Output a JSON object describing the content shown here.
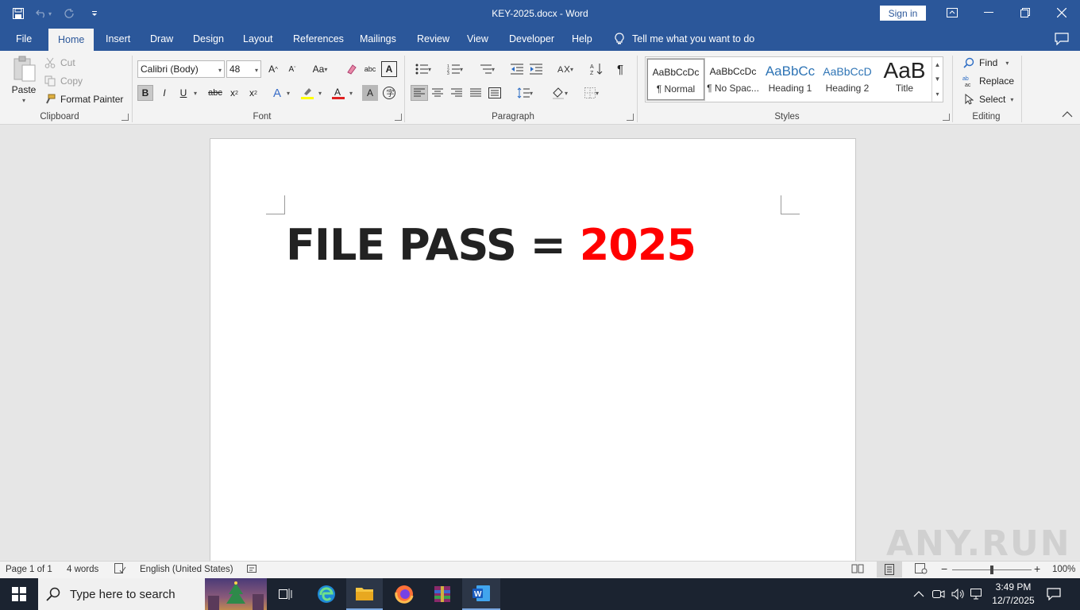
{
  "window": {
    "title": "KEY-2025.docx  -  Word",
    "signin_label": "Sign in"
  },
  "tabs": [
    {
      "label": "File"
    },
    {
      "label": "Home"
    },
    {
      "label": "Insert"
    },
    {
      "label": "Draw"
    },
    {
      "label": "Design"
    },
    {
      "label": "Layout"
    },
    {
      "label": "References"
    },
    {
      "label": "Mailings"
    },
    {
      "label": "Review"
    },
    {
      "label": "View"
    },
    {
      "label": "Developer"
    },
    {
      "label": "Help"
    }
  ],
  "tell_me": "Tell me what you want to do",
  "ribbon": {
    "clipboard": {
      "label": "Clipboard",
      "paste": "Paste",
      "cut": "Cut",
      "copy": "Copy",
      "format_painter": "Format Painter"
    },
    "font": {
      "label": "Font",
      "font_name": "Calibri (Body)",
      "font_size": "48"
    },
    "paragraph": {
      "label": "Paragraph"
    },
    "styles": {
      "label": "Styles",
      "items": [
        {
          "preview": "AaBbCcDc",
          "name": "¶ Normal"
        },
        {
          "preview": "AaBbCcDc",
          "name": "¶ No Spac..."
        },
        {
          "preview": "AaBbCc",
          "name": "Heading 1"
        },
        {
          "preview": "AaBbCcD",
          "name": "Heading 2"
        },
        {
          "preview": "AaB",
          "name": "Title"
        }
      ]
    },
    "editing": {
      "label": "Editing",
      "find": "Find",
      "replace": "Replace",
      "select": "Select"
    }
  },
  "document": {
    "text_black": "FILE PASS = ",
    "text_red": "2025",
    "red_color": "#ff0000"
  },
  "statusbar": {
    "page": "Page 1 of 1",
    "words": "4 words",
    "language": "English (United States)",
    "zoom": "100%"
  },
  "taskbar": {
    "search_placeholder": "Type here to search",
    "time": "3:49 PM",
    "date": "12/7/2025"
  },
  "watermark": "ANY.RUN",
  "colors": {
    "word_blue": "#2b579a",
    "ribbon_bg": "#f3f3f3",
    "taskbar_bg": "#1b2330"
  }
}
